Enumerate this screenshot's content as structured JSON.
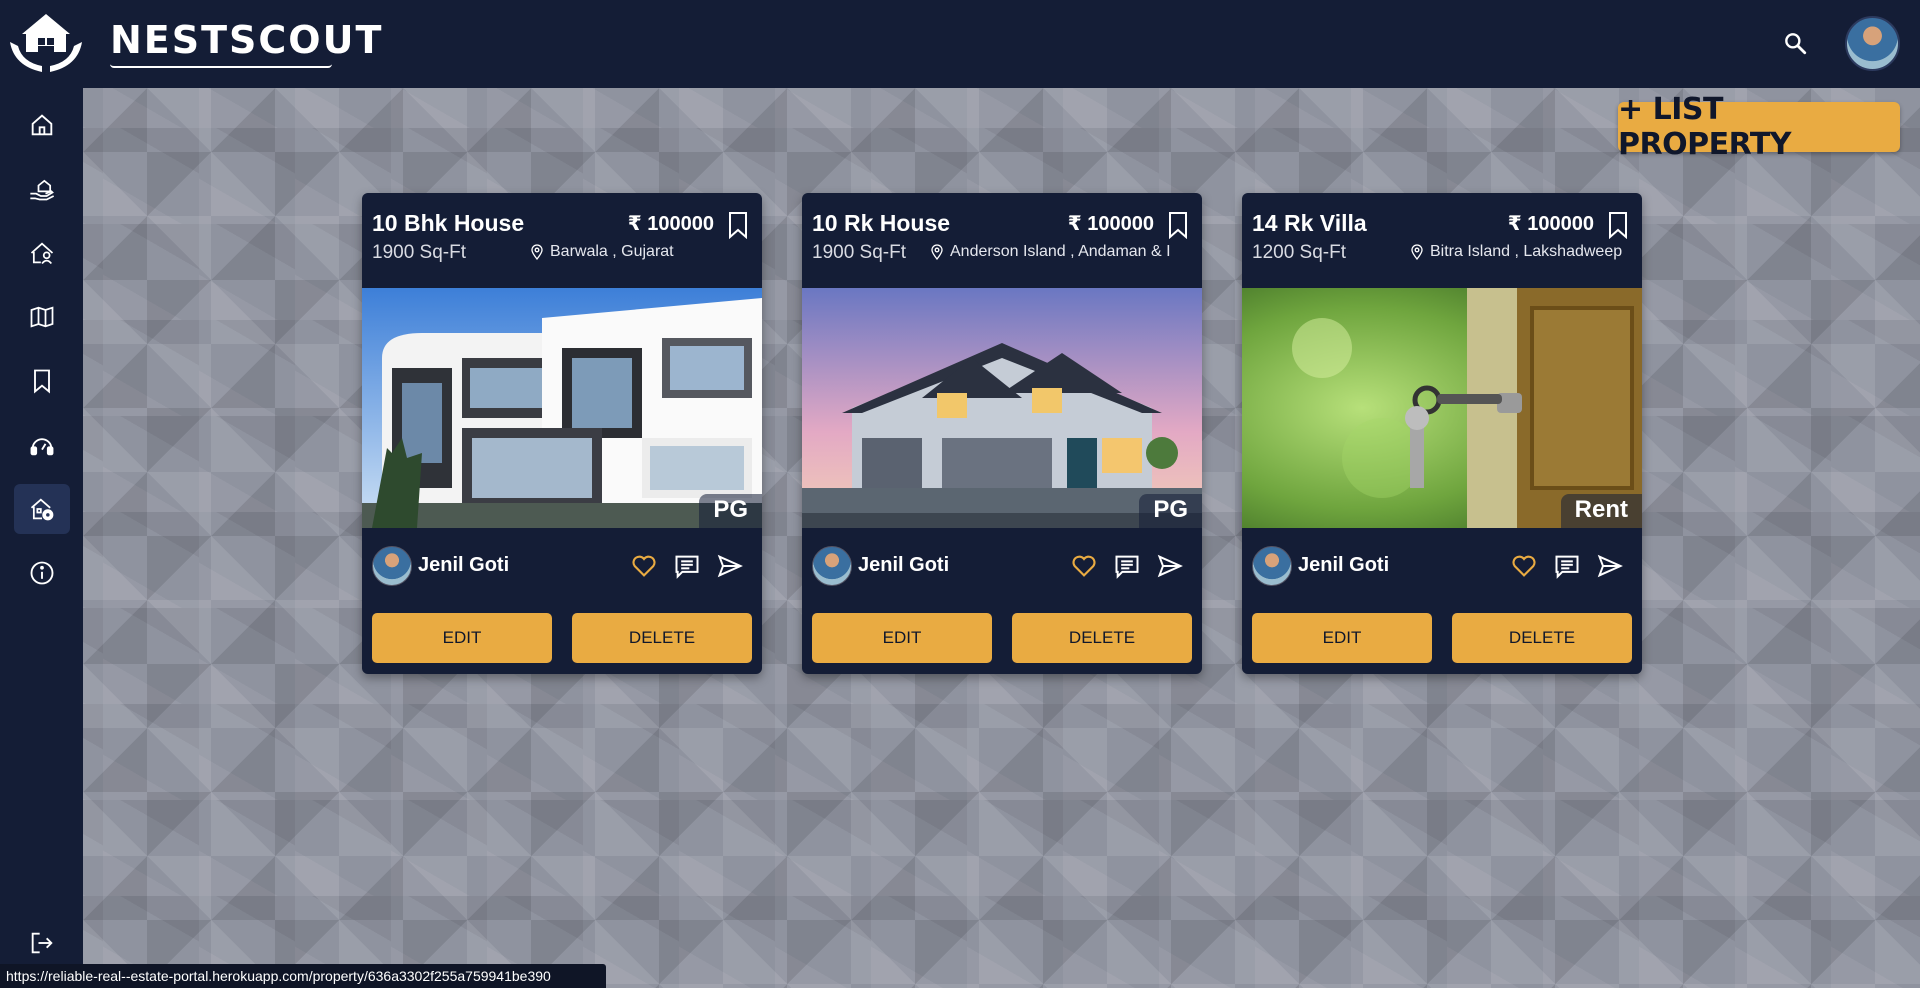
{
  "header": {
    "brand": "NESTSCOUT",
    "search_icon": "search-icon",
    "avatar_icon": "user-avatar"
  },
  "sidebar": {
    "items": [
      {
        "name": "home",
        "icon": "home-icon"
      },
      {
        "name": "buy",
        "icon": "house-hand-icon"
      },
      {
        "name": "agents",
        "icon": "house-user-icon"
      },
      {
        "name": "map",
        "icon": "map-icon"
      },
      {
        "name": "saved",
        "icon": "bookmark-icon"
      },
      {
        "name": "support",
        "icon": "headset-icon"
      },
      {
        "name": "my-properties",
        "icon": "house-settings-icon",
        "active": true
      },
      {
        "name": "about",
        "icon": "info-icon"
      },
      {
        "name": "logout",
        "icon": "logout-icon"
      }
    ]
  },
  "actions": {
    "list_property": "+ LIST PROPERTY"
  },
  "properties": [
    {
      "title": "10 Bhk House",
      "size": "1900 Sq-Ft",
      "price": "₹ 100000",
      "location": "Barwala , Gujarat",
      "tag": "PG",
      "owner": "Jenil Goti",
      "edit_label": "EDIT",
      "delete_label": "DELETE"
    },
    {
      "title": "10 Rk House",
      "size": "1900 Sq-Ft",
      "price": "₹ 100000",
      "location": "Anderson Island , Andaman & I",
      "tag": "PG",
      "owner": "Jenil Goti",
      "edit_label": "EDIT",
      "delete_label": "DELETE"
    },
    {
      "title": "14 Rk Villa",
      "size": "1200 Sq-Ft",
      "price": "₹ 100000",
      "location": "Bitra Island , Lakshadweep",
      "tag": "Rent",
      "owner": "Jenil Goti",
      "edit_label": "EDIT",
      "delete_label": "DELETE"
    }
  ],
  "status_bar": {
    "url": "https://reliable-real--estate-portal.herokuapp.com/property/636a3302f255a759941be390"
  },
  "colors": {
    "navy": "#141d36",
    "accent": "#e9ab42",
    "background": "#8f939f"
  }
}
